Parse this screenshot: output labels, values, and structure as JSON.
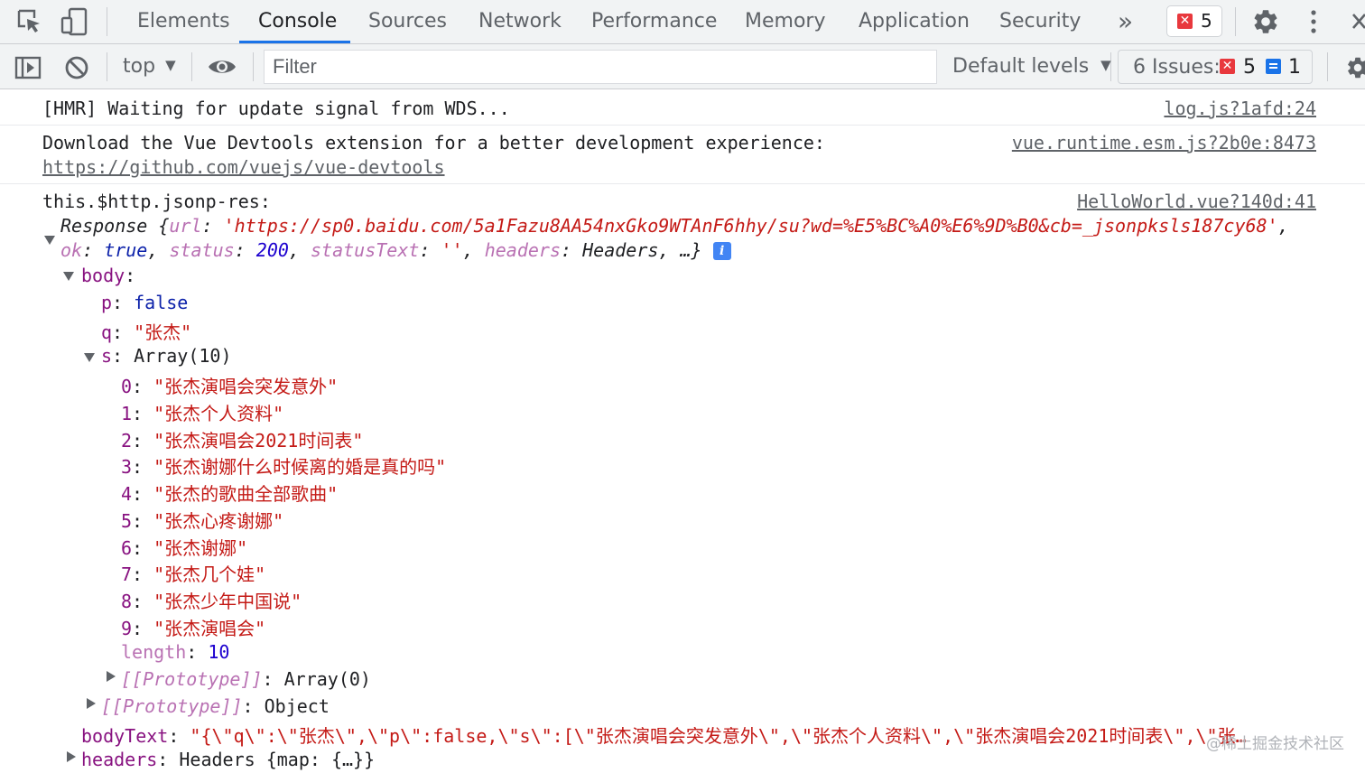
{
  "tabs": [
    {
      "label": "Elements"
    },
    {
      "label": "Console"
    },
    {
      "label": "Sources"
    },
    {
      "label": "Network"
    },
    {
      "label": "Performance"
    },
    {
      "label": "Memory"
    },
    {
      "label": "Application"
    },
    {
      "label": "Security"
    }
  ],
  "tabbar": {
    "more_tabs": "»",
    "error_count": "5"
  },
  "toolbar": {
    "context": "top",
    "filter_placeholder": "Filter",
    "levels": "Default levels",
    "issues_label": "6 Issues:",
    "issues_errors": "5",
    "issues_messages": "1"
  },
  "console": {
    "msg1": {
      "text": "[HMR] Waiting for update signal from WDS...",
      "source": "log.js?1afd:24"
    },
    "msg2": {
      "text": "Download the Vue Devtools extension for a better development experience:",
      "link": "https://github.com/vuejs/vue-devtools",
      "source": "vue.runtime.esm.js?2b0e:8473"
    },
    "msg3": {
      "label": "this.$http.jsonp-res:",
      "source": "HelloWorld.vue?140d:41",
      "preview_class": "Response",
      "url_key": "url",
      "url_value": "'https://sp0.baidu.com/5a1Fazu8AA54nxGko9WTAnF6hhy/su?wd=%E5%BC%A0%E6%9D%B0&cb=_jsonpksls187cy68'",
      "ok_key": "ok",
      "ok_value": "true",
      "status_key": "status",
      "status_value": "200",
      "statusText_key": "statusText",
      "statusText_value": "''",
      "headers_key": "headers",
      "headers_value": "Headers",
      "ellipsis": "…}",
      "body_key": "body",
      "p_key": "p",
      "p_value": "false",
      "q_key": "q",
      "q_value": "\"张杰\"",
      "s_key": "s",
      "s_value": "Array(10)",
      "items": [
        {
          "index": "0",
          "value": "\"张杰演唱会突发意外\""
        },
        {
          "index": "1",
          "value": "\"张杰个人资料\""
        },
        {
          "index": "2",
          "value": "\"张杰演唱会2021时间表\""
        },
        {
          "index": "3",
          "value": "\"张杰谢娜什么时候离的婚是真的吗\""
        },
        {
          "index": "4",
          "value": "\"张杰的歌曲全部歌曲\""
        },
        {
          "index": "5",
          "value": "\"张杰心疼谢娜\""
        },
        {
          "index": "6",
          "value": "\"张杰谢娜\""
        },
        {
          "index": "7",
          "value": "\"张杰几个娃\""
        },
        {
          "index": "8",
          "value": "\"张杰少年中国说\""
        },
        {
          "index": "9",
          "value": "\"张杰演唱会\""
        }
      ],
      "length_key": "length",
      "length_value": "10",
      "proto_key": "[[Prototype]]",
      "proto_array_value": "Array(0)",
      "proto_object_value": "Object",
      "bodyText_key": "bodyText",
      "bodyText_value": "\"{\\\"q\\\":\\\"张杰\\\",\\\"p\\\":false,\\\"s\\\":[\\\"张杰演唱会突发意外\\\",\\\"张杰个人资料\\\",\\\"张杰演唱会2021时间表\\\",\\\"张…",
      "headers_row_key": "headers",
      "headers_row_value": "Headers {map: {…}}"
    }
  },
  "watermark": "@稀土掘金技术社区"
}
